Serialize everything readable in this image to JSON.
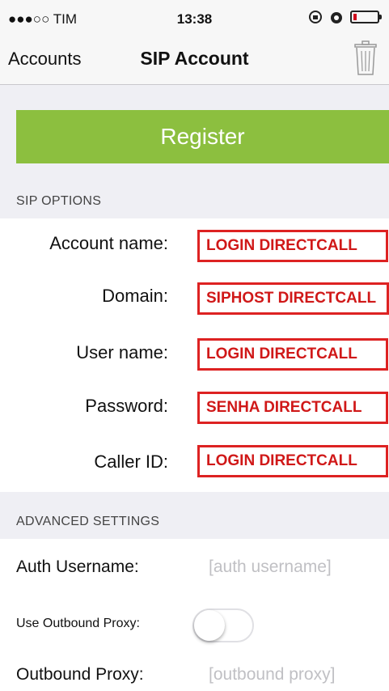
{
  "status_bar": {
    "carrier": "●●●○○ TIM",
    "time": "13:38"
  },
  "nav": {
    "back_label": "Accounts",
    "title": "SIP Account",
    "delete_icon": "trash-icon"
  },
  "register_label": "Register",
  "colors": {
    "register": "#8cbf3f",
    "field_border": "#dd2222",
    "field_text": "#d01818",
    "grouped_bg": "#efeff4"
  },
  "sip_options": {
    "header": "SIP OPTIONS",
    "fields": [
      {
        "label": "Account name:",
        "value": "LOGIN DIRECTCALL"
      },
      {
        "label": "Domain:",
        "value": "SIPHOST DIRECTCALL"
      },
      {
        "label": "User name:",
        "value": "LOGIN DIRECTCALL"
      },
      {
        "label": "Password:",
        "value": "SENHA DIRECTCALL"
      },
      {
        "label": "Caller ID:",
        "value": "LOGIN DIRECTCALL"
      }
    ]
  },
  "advanced": {
    "header": "ADVANCED SETTINGS",
    "auth_username": {
      "label": "Auth Username:",
      "placeholder": "[auth username]"
    },
    "use_outbound_proxy": {
      "label": "Use Outbound Proxy:",
      "on": false
    },
    "outbound_proxy": {
      "label": "Outbound Proxy:",
      "placeholder": "[outbound proxy]"
    }
  }
}
